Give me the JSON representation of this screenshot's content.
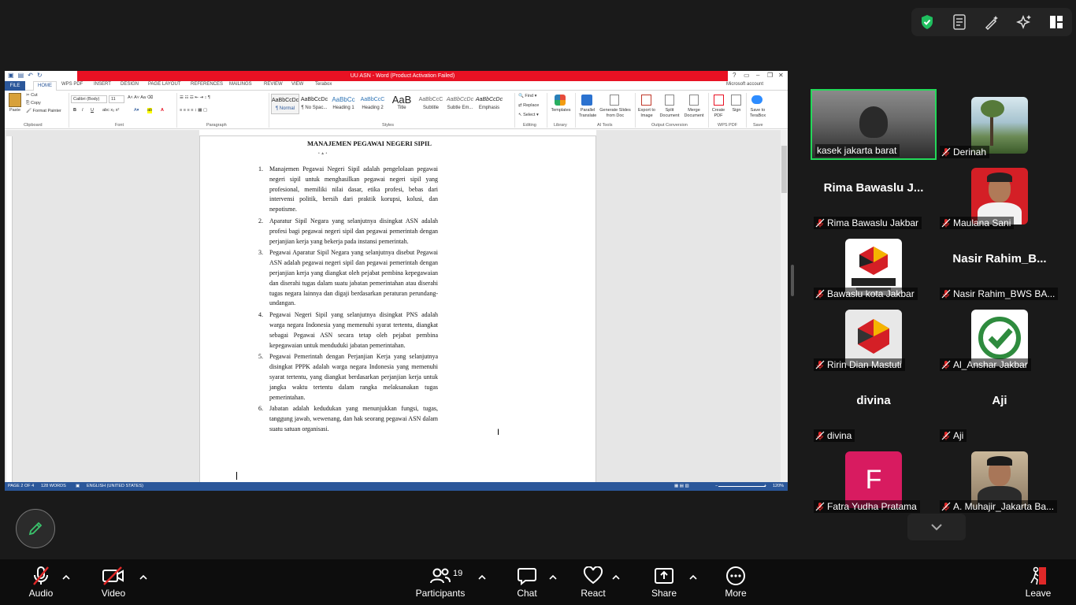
{
  "word": {
    "title": "UU ASN - Word (Product Activation Failed)",
    "account": "Microsoft account",
    "tabs": [
      "FILE",
      "HOME",
      "WPS PDF",
      "INSERT",
      "DESIGN",
      "PAGE LAYOUT",
      "REFERENCES",
      "MAILINGS",
      "REVIEW",
      "VIEW",
      "Terabox"
    ],
    "clipboard": {
      "paste": "Paste",
      "cut": "Cut",
      "copy": "Copy",
      "format_painter": "Format Painter",
      "label": "Clipboard"
    },
    "font": {
      "name": "Calibri (Body)",
      "size": "11",
      "label": "Font"
    },
    "paragraph_label": "Paragraph",
    "styles": [
      {
        "preview": "AaBbCcDc",
        "name": "¶ Normal"
      },
      {
        "preview": "AaBbCcDc",
        "name": "¶ No Spac..."
      },
      {
        "preview": "AaBbCc",
        "name": "Heading 1"
      },
      {
        "preview": "AaBbCcC",
        "name": "Heading 2"
      },
      {
        "preview": "AaB",
        "name": "Title"
      },
      {
        "preview": "AaBbCcC",
        "name": "Subtitle"
      },
      {
        "preview": "AaBbCcDc",
        "name": "Subtle Em..."
      },
      {
        "preview": "AaBbCcDc",
        "name": "Emphasis"
      }
    ],
    "styles_label": "Styles",
    "editing": {
      "find": "Find",
      "replace": "Replace",
      "select": "Select",
      "label": "Editing"
    },
    "library": {
      "templates": "Templates",
      "label": "Library"
    },
    "ai_tools": {
      "parallel": "Parallel Translate",
      "generate": "Generate Slides from Doc",
      "label": "AI Tools"
    },
    "output": {
      "export": "Export to Image",
      "split": "Split Document",
      "merge": "Merge Document",
      "label": "Output Conversion"
    },
    "wps_pdf": {
      "create": "Create PDF",
      "sign": "Sign",
      "label": "WPS PDF"
    },
    "save": {
      "terabox": "Save to TeraBox",
      "label": "Save"
    },
    "doc_title": "MANAJEMEN PEGAWAI NEGERI SIPIL",
    "points": [
      {
        "num": "1.",
        "text": "Manajemen Pegawai Negeri Sipil adalah pengelolaan pegawai negeri sipil untuk menghasilkan pegawai negeri sipil yang profesional, memiliki nilai dasar, etika profesi, bebas dari intervensi politik, bersih dari praktik korupsi, kolusi, dan nepotisme."
      },
      {
        "num": "2.",
        "text": "Aparatur Sipil Negara yang selanjutnya disingkat ASN adalah profesi bagi pegawai negeri sipil dan pegawai pemerintah dengan perjanjian kerja yang bekerja pada instansi pemerintah."
      },
      {
        "num": "3.",
        "text": "Pegawai Aparatur Sipil Negara yang selanjutnya disebut Pegawai ASN adalah pegawai negeri sipil dan pegawai pemerintah dengan perjanjian kerja yang diangkat oleh pejabat pembina kepegawaian dan diserahi tugas dalam suatu jabatan pemerintahan atau diserahi tugas negara lainnya dan digaji berdasarkan peraturan perundang-undangan."
      },
      {
        "num": "4.",
        "text": "Pegawai Negeri Sipil yang selanjutnya disingkat PNS adalah warga negara Indonesia yang memenuhi syarat tertentu, diangkat sebagai Pegawai ASN secara tetap oleh pejabat pembina kepegawaian untuk menduduki jabatan pemerintahan."
      },
      {
        "num": "5.",
        "text": "Pegawai Pemerintah dengan Perjanjian Kerja yang selanjutnya disingkat PPPK adalah warga negara Indonesia yang memenuhi syarat tertentu, yang diangkat berdasarkan perjanjian kerja untuk jangka waktu tertentu dalam rangka melaksanakan tugas pemerintahan."
      },
      {
        "num": "6.",
        "text": "Jabatan adalah kedudukan yang menunjukkan fungsi, tugas, tanggung jawab, wewenang, dan hak seorang pegawai ASN dalam suatu satuan organisasi."
      }
    ],
    "status": {
      "page": "PAGE 2 OF 4",
      "words": "128 WORDS",
      "lang": "ENGLISH (UNITED STATES)",
      "zoom": "120%"
    }
  },
  "participants": [
    {
      "label": "kasek jakarta barat",
      "muted": false,
      "big": "",
      "type": "video"
    },
    {
      "label": "Derinah",
      "muted": true,
      "big": "",
      "type": "landscape"
    },
    {
      "label": "Rima Bawaslu Jakbar",
      "muted": true,
      "big": "Rima Bawaslu J...",
      "type": "name"
    },
    {
      "label": "Maulana Sani",
      "muted": true,
      "big": "",
      "type": "portrait"
    },
    {
      "label": "Bawaslu kota Jakbar",
      "muted": true,
      "big": "",
      "type": "bawaslu"
    },
    {
      "label": "Nasir Rahim_BWS BA...",
      "muted": true,
      "big": "Nasir  Rahim_B...",
      "type": "name"
    },
    {
      "label": "Ririn Dian Mastuti",
      "muted": true,
      "big": "",
      "type": "logo2"
    },
    {
      "label": "Al_Anshar Jakbar",
      "muted": true,
      "big": "",
      "type": "check"
    },
    {
      "label": "divina",
      "muted": true,
      "big": "divina",
      "type": "name"
    },
    {
      "label": "Aji",
      "muted": true,
      "big": "Aji",
      "type": "name"
    },
    {
      "label": "Fatra Yudha Pratama",
      "muted": true,
      "big": "",
      "type": "letter",
      "letter": "F"
    },
    {
      "label": "A. Muhajir_Jakarta Ba...",
      "muted": true,
      "big": "",
      "type": "portrait2"
    }
  ],
  "bottombar": {
    "audio": "Audio",
    "video": "Video",
    "participants": "Participants",
    "participants_count": "19",
    "chat": "Chat",
    "react": "React",
    "share": "Share",
    "more": "More",
    "leave": "Leave"
  },
  "colors": {
    "accent": "#2b579a",
    "title_red": "#e81123",
    "active_speaker": "#23d959",
    "leave": "#e02828"
  }
}
